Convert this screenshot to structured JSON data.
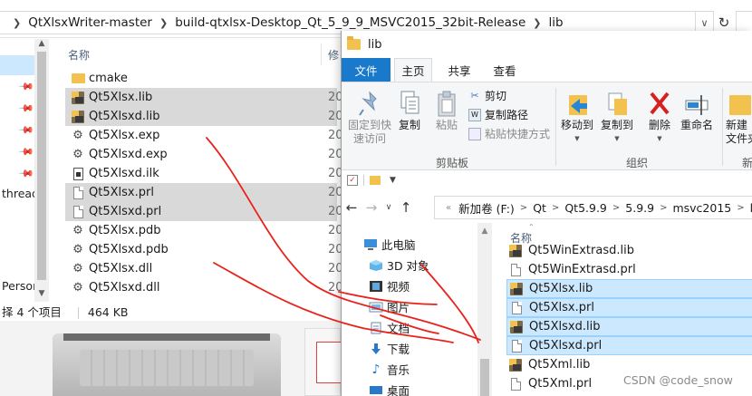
{
  "background_window": {
    "breadcrumbs": [
      "QtXlsxWriter-master",
      "build-qtxlsx-Desktop_Qt_5_9_9_MSVC2015_32bit-Release",
      "lib"
    ],
    "refresh_icon": "refresh-icon",
    "nav_items": [
      "thread",
      "Persona"
    ],
    "column_name": "名称",
    "column_modified": "修",
    "files": [
      {
        "name": "cmake",
        "icon": "folder",
        "date": "",
        "selected": false
      },
      {
        "name": "Qt5Xlsx.lib",
        "icon": "lib",
        "date": "20",
        "selected": true
      },
      {
        "name": "Qt5Xlsxd.lib",
        "icon": "lib",
        "date": "20",
        "selected": true
      },
      {
        "name": "Qt5Xlsx.exp",
        "icon": "gear",
        "date": "20",
        "selected": false
      },
      {
        "name": "Qt5Xlsxd.exp",
        "icon": "gear",
        "date": "20",
        "selected": false
      },
      {
        "name": "Qt5Xlsxd.ilk",
        "icon": "ilk",
        "date": "20",
        "selected": false
      },
      {
        "name": "Qt5Xlsx.prl",
        "icon": "doc",
        "date": "20",
        "selected": true
      },
      {
        "name": "Qt5Xlsxd.prl",
        "icon": "doc",
        "date": "20",
        "selected": true
      },
      {
        "name": "Qt5Xlsx.pdb",
        "icon": "pdb",
        "date": "20",
        "selected": false
      },
      {
        "name": "Qt5Xlsxd.pdb",
        "icon": "pdb",
        "date": "20",
        "selected": false
      },
      {
        "name": "Qt5Xlsx.dll",
        "icon": "gear",
        "date": "20",
        "selected": false
      },
      {
        "name": "Qt5Xlsxd.dll",
        "icon": "gear",
        "date": "20",
        "selected": false
      }
    ],
    "status_count": "择 4 个项目",
    "status_size": "464 KB"
  },
  "front_window": {
    "title": "lib",
    "tabs": [
      "文件",
      "主页",
      "共享",
      "查看"
    ],
    "ribbon": {
      "pin_label_1": "固定到快",
      "pin_label_2": "速访问",
      "copy": "复制",
      "paste": "粘贴",
      "cut": "剪切",
      "copy_path": "复制路径",
      "paste_shortcut": "粘贴快捷方式",
      "clipboard_group": "剪贴板",
      "move_to": "移动到",
      "copy_to": "复制到",
      "delete": "删除",
      "rename": "重命名",
      "organize_group": "组织",
      "new_folder_1": "新建",
      "new_folder_2": "文件夹",
      "new_group": "新"
    },
    "address": [
      "新加卷 (F:)",
      "Qt",
      "Qt5.9.9",
      "5.9.9",
      "msvc2015",
      "lib"
    ],
    "nav_items": [
      {
        "label": "此电脑",
        "icon": "computer-icon"
      },
      {
        "label": "3D 对象",
        "icon": "cube-icon"
      },
      {
        "label": "视频",
        "icon": "video-icon"
      },
      {
        "label": "图片",
        "icon": "picture-icon"
      },
      {
        "label": "文档",
        "icon": "document-icon"
      },
      {
        "label": "下载",
        "icon": "download-icon"
      },
      {
        "label": "音乐",
        "icon": "music-icon"
      },
      {
        "label": "桌面",
        "icon": "desktop-icon"
      }
    ],
    "column_name": "名称",
    "files": [
      {
        "name": "Qt5WinExtrasd.lib",
        "icon": "lib",
        "selected": false
      },
      {
        "name": "Qt5WinExtrasd.prl",
        "icon": "doc",
        "selected": false
      },
      {
        "name": "Qt5Xlsx.lib",
        "icon": "lib",
        "selected": true
      },
      {
        "name": "Qt5Xlsx.prl",
        "icon": "doc",
        "selected": true
      },
      {
        "name": "Qt5Xlsxd.lib",
        "icon": "lib",
        "selected": true
      },
      {
        "name": "Qt5Xlsxd.prl",
        "icon": "doc",
        "selected": true
      },
      {
        "name": "Qt5Xml.lib",
        "icon": "lib",
        "selected": false
      },
      {
        "name": "Qt5Xml.prl",
        "icon": "doc",
        "selected": false
      }
    ]
  },
  "watermark": "CSDN @code_snow",
  "annotation_color": "#e8221b"
}
